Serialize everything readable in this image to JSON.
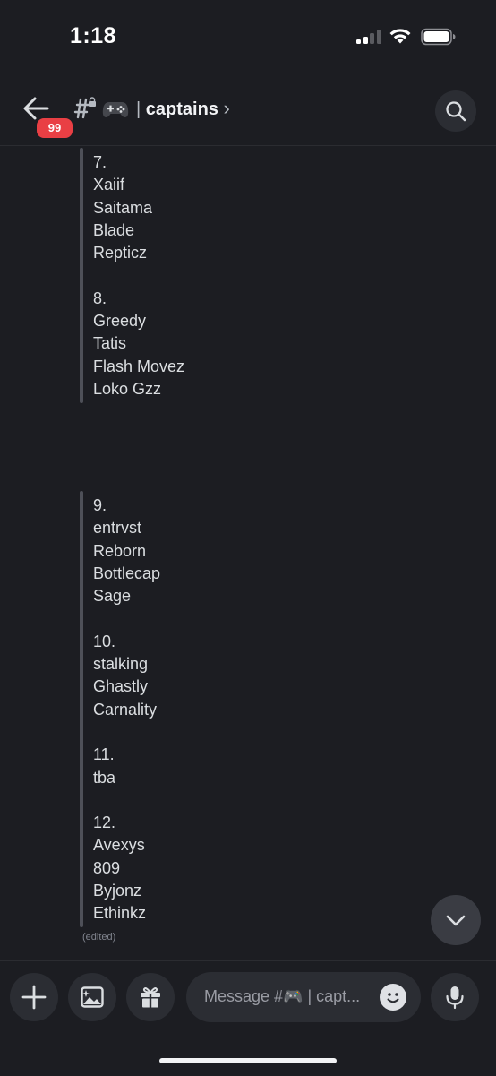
{
  "status_bar": {
    "time": "1:18"
  },
  "header": {
    "back_badge": "99",
    "channel_prefix": "#",
    "channel_emoji": "controller-emoji",
    "channel_separator": "|",
    "channel_name": "captains",
    "chevron": "›"
  },
  "message": {
    "block1": [
      "7.",
      "Xaiif",
      "Saitama",
      "Blade",
      "Repticz",
      "",
      "8.",
      "Greedy",
      "Tatis",
      "Flash Movez",
      "Loko Gzz"
    ],
    "block2": [
      "9.",
      "entrvst",
      "Reborn",
      "Bottlecap",
      "Sage",
      "",
      "10.",
      "stalking",
      "Ghastly",
      "Carnality",
      "",
      "11.",
      "tba",
      "",
      "12.",
      "Avexys",
      "809",
      "Byjonz",
      "Ethinkz"
    ],
    "edited": "(edited)"
  },
  "composer": {
    "placeholder": "Message #🎮 | capt..."
  },
  "colors": {
    "background": "#1c1d22",
    "badge": "#e93f44",
    "quote_bar": "#4e5058"
  }
}
